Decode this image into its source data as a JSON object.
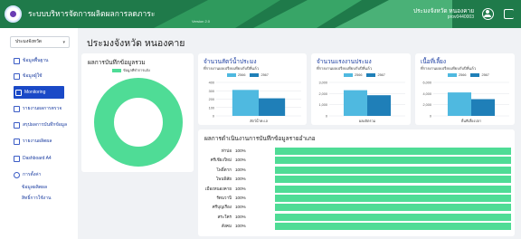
{
  "header": {
    "app_title": "ระบบบริหารจัดการผลิตผลการลดภาระ",
    "app_version": "Version 2.0",
    "user_name": "ประมงจังหวัด หนองคาย",
    "user_id": "prov0440003",
    "colors": {
      "bar": "#1f7a4a",
      "accent": "#2aa766"
    }
  },
  "sidebar": {
    "province_select": "ประมงจังหวัด",
    "items": [
      {
        "label": "ข้อมูลพื้นฐาน",
        "icon": "bar-chart-icon",
        "active": false
      },
      {
        "label": "ข้อมูลผู้ใช้",
        "icon": "id-card-icon",
        "active": false
      },
      {
        "label": "Monitoring",
        "icon": "monitor-grid-icon",
        "active": true
      },
      {
        "label": "รายงานผลการตรวจ",
        "icon": "report-icon",
        "active": false
      },
      {
        "label": "สรุปผลการบันทึกข้อมูล",
        "icon": "document-icon",
        "active": false
      },
      {
        "label": "รายงานผลิตผล",
        "icon": "document-icon",
        "active": false
      },
      {
        "label": "Dashboard A4",
        "icon": "dashboard-icon",
        "active": false
      },
      {
        "label": "การตั้งค่า",
        "icon": "gear-icon",
        "active": false
      }
    ],
    "subitems": [
      "ข้อมูลผลิตผล",
      "สิทธิ์การใช้งาน"
    ]
  },
  "main": {
    "page_title": "ประมงจังหวัด หนองคาย",
    "summary_card": {
      "title": "ผลการบันทึกข้อมูลรวม",
      "legend": "ข้อมูลที่ทำการแจ้ง",
      "color": "#4fdc96"
    },
    "chart_cards": [
      {
        "title": "จำนวนสัตว์น้ำประมง",
        "subtitle": "ที่รายงานผลเปรียบเทียบกับปีที่แล้ว",
        "xlabel": "สัตว์น้ำทะเล"
      },
      {
        "title": "จำนวนแรงงานประมง",
        "subtitle": "ที่รายงานผลเปรียบเทียบกับปีที่แล้ว",
        "xlabel": "ผลผลิตรวม"
      },
      {
        "title": "เนื้อที่เลี้ยง",
        "subtitle": "ที่รายงานผลเปรียบเทียบกับปีที่แล้ว",
        "xlabel": "พื้นที่เลี้ยงปลา"
      }
    ],
    "district_card": {
      "title": "ผลการดำเนินงานการบันทึกข้อมูลรายอำเภอ"
    }
  },
  "chart_data": [
    {
      "type": "pie",
      "title": "ผลการบันทึกข้อมูลรวม",
      "slices": [
        {
          "label": "ข้อมูลที่ทำการแจ้ง",
          "value": 100
        }
      ],
      "donut": true
    },
    {
      "type": "bar",
      "title": "จำนวนสัตว์น้ำประมง",
      "categories": [
        "สัตว์น้ำทะเล"
      ],
      "series": [
        {
          "name": "2566",
          "values": [
            310
          ],
          "color": "#4fb9e0"
        },
        {
          "name": "2567",
          "values": [
            210
          ],
          "color": "#1f7fb8"
        }
      ],
      "yticks": [
        "400",
        "300",
        "200",
        "100",
        "0"
      ],
      "ylim": [
        0,
        400
      ]
    },
    {
      "type": "bar",
      "title": "จำนวนแรงงานประมง",
      "categories": [
        "ผลผลิตรวม"
      ],
      "series": [
        {
          "name": "2566",
          "values": [
            2300
          ],
          "color": "#4fb9e0"
        },
        {
          "name": "2567",
          "values": [
            1850
          ],
          "color": "#1f7fb8"
        }
      ],
      "yticks": [
        "3,000",
        "2,000",
        "1,000",
        "0"
      ],
      "ylim": [
        0,
        3000
      ]
    },
    {
      "type": "bar",
      "title": "เนื้อที่เลี้ยง",
      "categories": [
        "พื้นที่เลี้ยงปลา"
      ],
      "series": [
        {
          "name": "2566",
          "values": [
            4200
          ],
          "color": "#4fb9e0"
        },
        {
          "name": "2567",
          "values": [
            3000
          ],
          "color": "#1f7fb8"
        }
      ],
      "yticks": [
        "6,000",
        "4,000",
        "2,000",
        "0"
      ],
      "ylim": [
        0,
        6000
      ]
    },
    {
      "type": "bar",
      "title": "ผลการดำเนินงานการบันทึกข้อมูลรายอำเภอ",
      "orientation": "horizontal",
      "categories": [
        "ท่าบ่อ",
        "ศรีเชียงใหม่",
        "โพธิ์ตาก",
        "โพนพิสัย",
        "เมืองหนองคาย",
        "รัตนวาปี",
        "ศรีบุญเรือง",
        "สระใคร",
        "สังคม"
      ],
      "values": [
        100,
        100,
        100,
        100,
        100,
        100,
        100,
        100,
        100
      ],
      "value_labels": [
        "100%",
        "100%",
        "100%",
        "100%",
        "100%",
        "100%",
        "100%",
        "100%",
        "100%"
      ],
      "xlim": [
        0,
        100
      ],
      "color": "#4fdc96"
    }
  ]
}
